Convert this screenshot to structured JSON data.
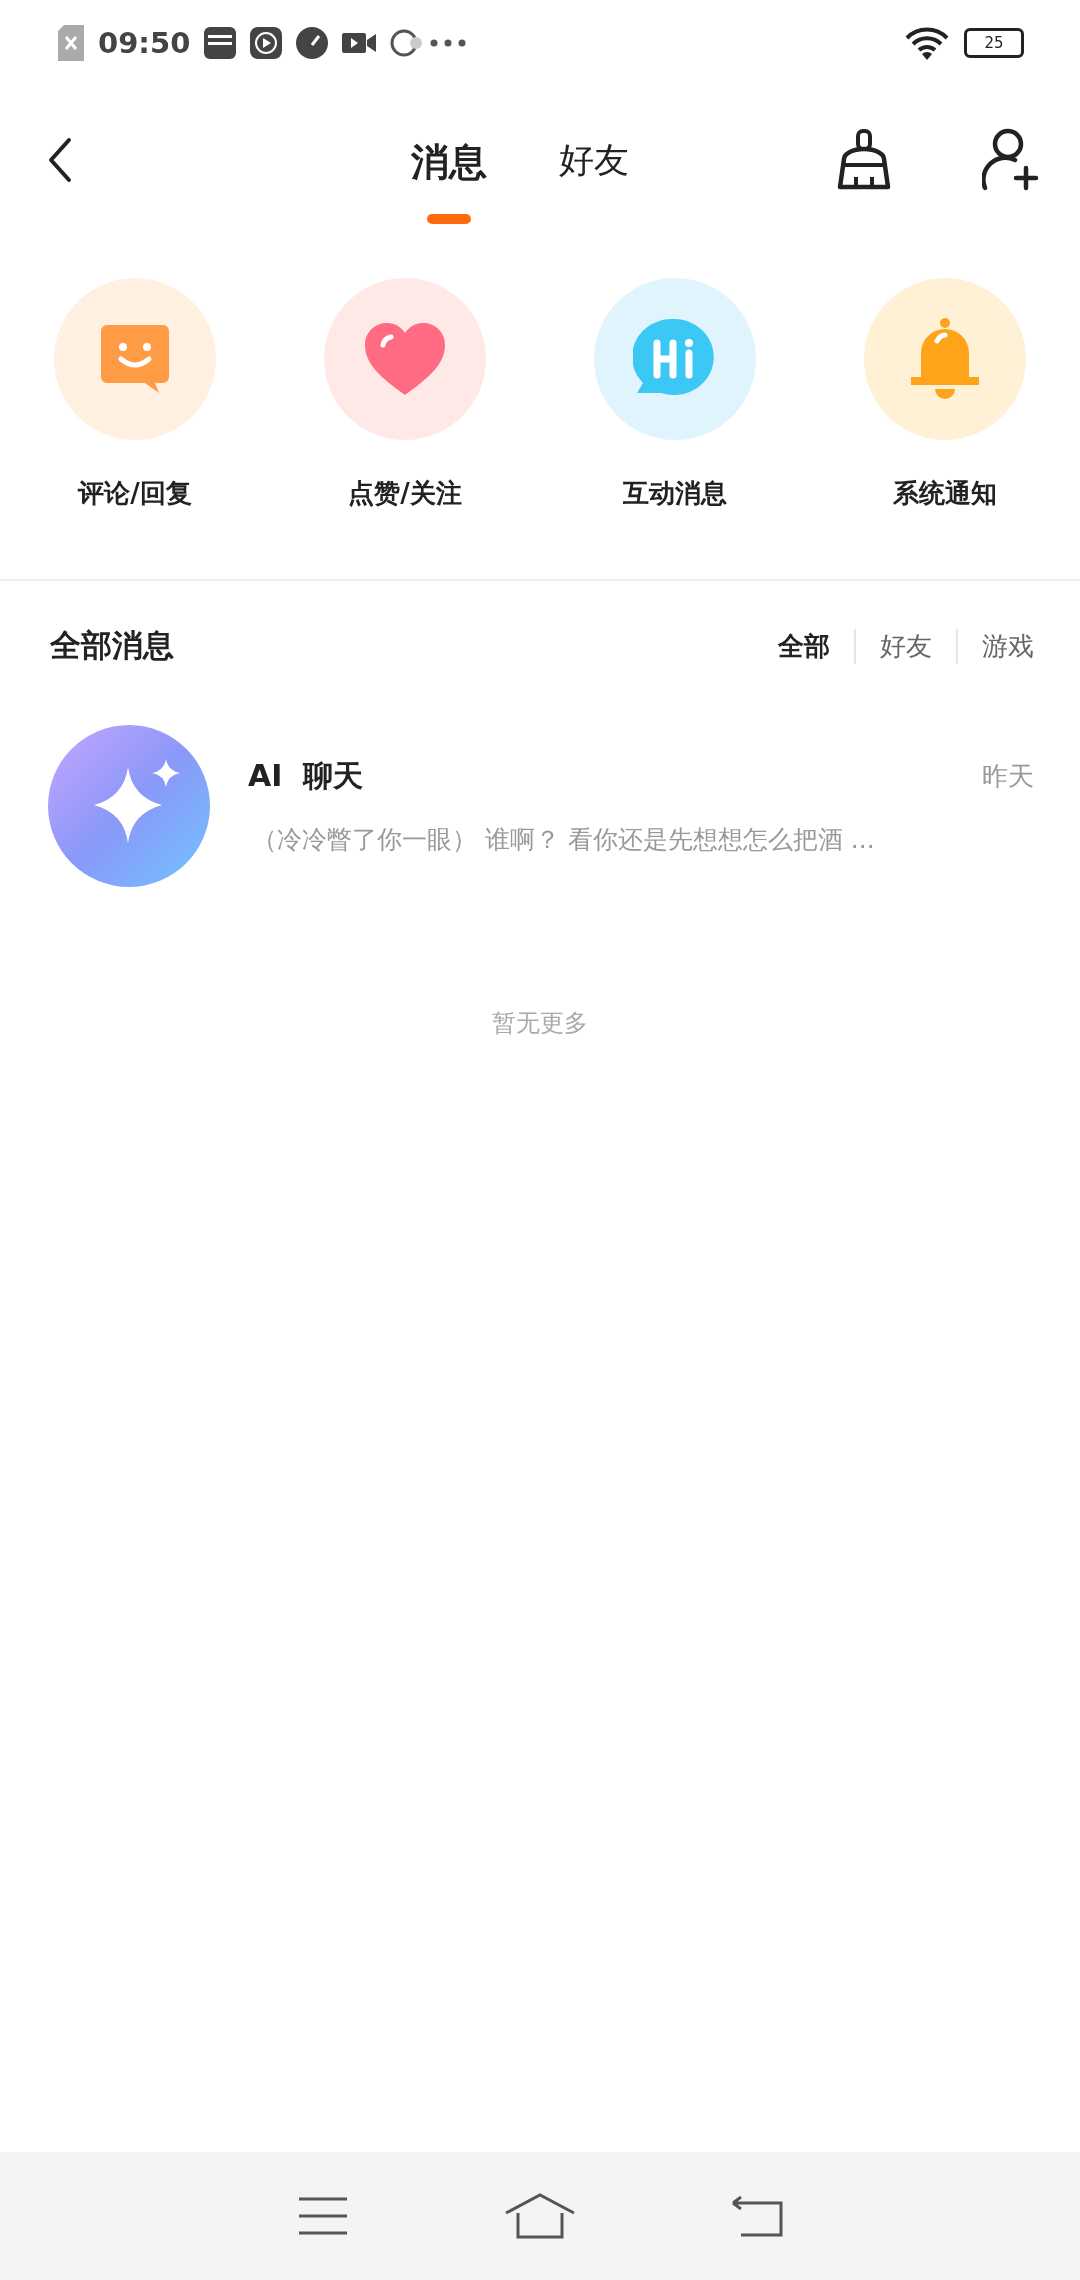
{
  "status_bar": {
    "time": "09:50",
    "battery": "25"
  },
  "header": {
    "tabs": [
      {
        "label": "消息",
        "selected": true
      },
      {
        "label": "好友",
        "selected": false
      }
    ]
  },
  "shortcuts": [
    {
      "label": "评论/回复",
      "kind": "comment"
    },
    {
      "label": "点赞/关注",
      "kind": "like"
    },
    {
      "label": "互动消息",
      "kind": "hi"
    },
    {
      "label": "系统通知",
      "kind": "notice"
    }
  ],
  "all_messages": {
    "title": "全部消息",
    "filters": [
      {
        "label": "全部",
        "selected": true
      },
      {
        "label": "好友",
        "selected": false
      },
      {
        "label": "游戏",
        "selected": false
      }
    ]
  },
  "conversations": [
    {
      "name": "AI  聊天",
      "time": "昨天",
      "preview": "（冷冷瞥了你一眼） 谁啊？ 看你还是先想想怎么把酒 ..."
    }
  ],
  "end_note": "暂无更多"
}
